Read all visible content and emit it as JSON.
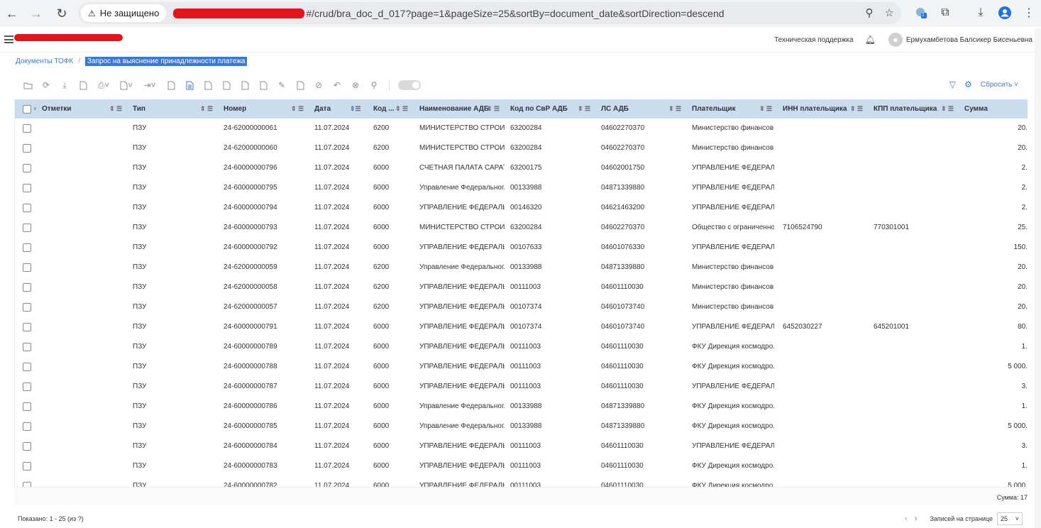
{
  "browser": {
    "security_label": "Не защищено",
    "url": "#/crud/bra_doc_d_017?page=1&pageSize=25&sortBy=document_date&sortDirection=descend",
    "ext_badge": "1"
  },
  "header": {
    "support": "Техническая поддержка",
    "user": "Ермухамбетова Балсикер Бисеньевна"
  },
  "breadcrumb": {
    "parent": "Документы ТОФК",
    "separator": "/",
    "current": "Запрос на выяснение принадлежности платежа"
  },
  "toolbar": {
    "reset_label": "Сбросить"
  },
  "table": {
    "columns": [
      "Отметки",
      "Тип",
      "Номер",
      "Дата",
      "Код ...",
      "Наименование АДБ",
      "Код по СвР АДБ",
      "ЛС АДБ",
      "Плательщик",
      "ИНН плательщика",
      "КПП плательщика",
      "Сумма"
    ],
    "rows": [
      [
        "ПЗУ",
        "24-62000000061",
        "11.07.2024",
        "6200",
        "МИНИСТЕРСТВО СТРОИТ...",
        "63200284",
        "04602270370",
        "Министерство финансов ...",
        "",
        "",
        "20."
      ],
      [
        "ПЗУ",
        "24-62000000060",
        "11.07.2024",
        "6200",
        "МИНИСТЕРСТВО СТРОИТ...",
        "63200284",
        "04602270370",
        "Министерство финансов ...",
        "",
        "",
        "20."
      ],
      [
        "ПЗУ",
        "24-60000000796",
        "11.07.2024",
        "6000",
        "СЧЕТНАЯ ПАЛАТА САРАТ...",
        "63200175",
        "04602001750",
        "УПРАВЛЕНИЕ ФЕДЕРАЛЬ...",
        "",
        "",
        "2."
      ],
      [
        "ПЗУ",
        "24-60000000795",
        "11.07.2024",
        "6000",
        "Управление Федеральног...",
        "00133988",
        "04871339880",
        "УПРАВЛЕНИЕ ФЕДЕРАЛЬ...",
        "",
        "",
        "2."
      ],
      [
        "ПЗУ",
        "24-60000000794",
        "11.07.2024",
        "6000",
        "УПРАВЛЕНИЕ ФЕДЕРАЛЬ...",
        "00146320",
        "04621463200",
        "УПРАВЛЕНИЕ ФЕДЕРАЛЬ...",
        "",
        "",
        "2."
      ],
      [
        "ПЗУ",
        "24-60000000793",
        "11.07.2024",
        "6000",
        "МИНИСТЕРСТВО СТРОИТ...",
        "63200284",
        "04602270370",
        "Общество с ограниченной...",
        "7106524790",
        "770301001",
        "25."
      ],
      [
        "ПЗУ",
        "24-60000000792",
        "11.07.2024",
        "6000",
        "УПРАВЛЕНИЕ ФЕДЕРАЛЬ...",
        "00107633",
        "04601076330",
        "УПРАВЛЕНИЕ ФЕДЕРАЛЬ...",
        "",
        "",
        "150."
      ],
      [
        "ПЗУ",
        "24-62000000059",
        "11.07.2024",
        "6200",
        "Управление Федеральног...",
        "00133988",
        "04871339880",
        "Министерство финансов ...",
        "",
        "",
        "20."
      ],
      [
        "ПЗУ",
        "24-62000000058",
        "11.07.2024",
        "6200",
        "УПРАВЛЕНИЕ ФЕДЕРАЛЬ...",
        "00111003",
        "04601110030",
        "Министерство финансов ...",
        "",
        "",
        "20."
      ],
      [
        "ПЗУ",
        "24-62000000057",
        "11.07.2024",
        "6200",
        "УПРАВЛЕНИЕ ФЕДЕРАЛЬ...",
        "00107374",
        "04601073740",
        "Министерство финансов ...",
        "",
        "",
        "20."
      ],
      [
        "ПЗУ",
        "24-60000000791",
        "11.07.2024",
        "6000",
        "УПРАВЛЕНИЕ ФЕДЕРАЛЬ...",
        "00107374",
        "04601073740",
        "УПРАВЛЕНИЕ ФЕДЕРАЛЬ...",
        "6452030227",
        "645201001",
        "80."
      ],
      [
        "ПЗУ",
        "24-60000000789",
        "11.07.2024",
        "6000",
        "УПРАВЛЕНИЕ ФЕДЕРАЛЬ...",
        "00111003",
        "04601110030",
        "ФКУ Дирекция космодро...",
        "",
        "",
        "1."
      ],
      [
        "ПЗУ",
        "24-60000000788",
        "11.07.2024",
        "6000",
        "УПРАВЛЕНИЕ ФЕДЕРАЛЬ...",
        "00111003",
        "04601110030",
        "ФКУ Дирекция космодро...",
        "",
        "",
        "5 000."
      ],
      [
        "ПЗУ",
        "24-60000000787",
        "11.07.2024",
        "6000",
        "УПРАВЛЕНИЕ ФЕДЕРАЛЬ...",
        "00111003",
        "04601110030",
        "УПРАВЛЕНИЕ ФЕДЕРАЛЬ...",
        "",
        "",
        "3."
      ],
      [
        "ПЗУ",
        "24-60000000786",
        "11.07.2024",
        "6000",
        "Управление Федеральног...",
        "00133988",
        "04871339880",
        "ФКУ Дирекция космодро...",
        "",
        "",
        "1."
      ],
      [
        "ПЗУ",
        "24-60000000785",
        "11.07.2024",
        "6000",
        "Управление Федеральног...",
        "00133988",
        "04871339880",
        "ФКУ Дирекция космодро...",
        "",
        "",
        "5 000."
      ],
      [
        "ПЗУ",
        "24-60000000784",
        "11.07.2024",
        "6000",
        "УПРАВЛЕНИЕ ФЕДЕРАЛЬ...",
        "00111003",
        "04601110030",
        "УПРАВЛЕНИЕ ФЕДЕРАЛЬ...",
        "",
        "",
        "3."
      ],
      [
        "ПЗУ",
        "24-60000000783",
        "11.07.2024",
        "6000",
        "УПРАВЛЕНИЕ ФЕДЕРАЛЬ...",
        "00111003",
        "04601110030",
        "ФКУ Дирекция космодро...",
        "",
        "",
        "1."
      ],
      [
        "ПЗУ",
        "24-60000000782",
        "11.07.2024",
        "6000",
        "УПРАВЛЕНИЕ ФЕДЕРАЛЬ...",
        "00111003",
        "04601110030",
        "ФКУ Дирекция космодро...",
        "",
        "",
        "5 000."
      ]
    ]
  },
  "footer": {
    "sum_label": "Сумма: 17",
    "shown": "Показано: 1 - 25 (из ?)",
    "per_page_label": "Записей на странице",
    "per_page_value": "25"
  },
  "colors": {
    "header_bg": "#c9ddef",
    "accent": "#3a7bd5",
    "redaction": "#e3121b"
  }
}
